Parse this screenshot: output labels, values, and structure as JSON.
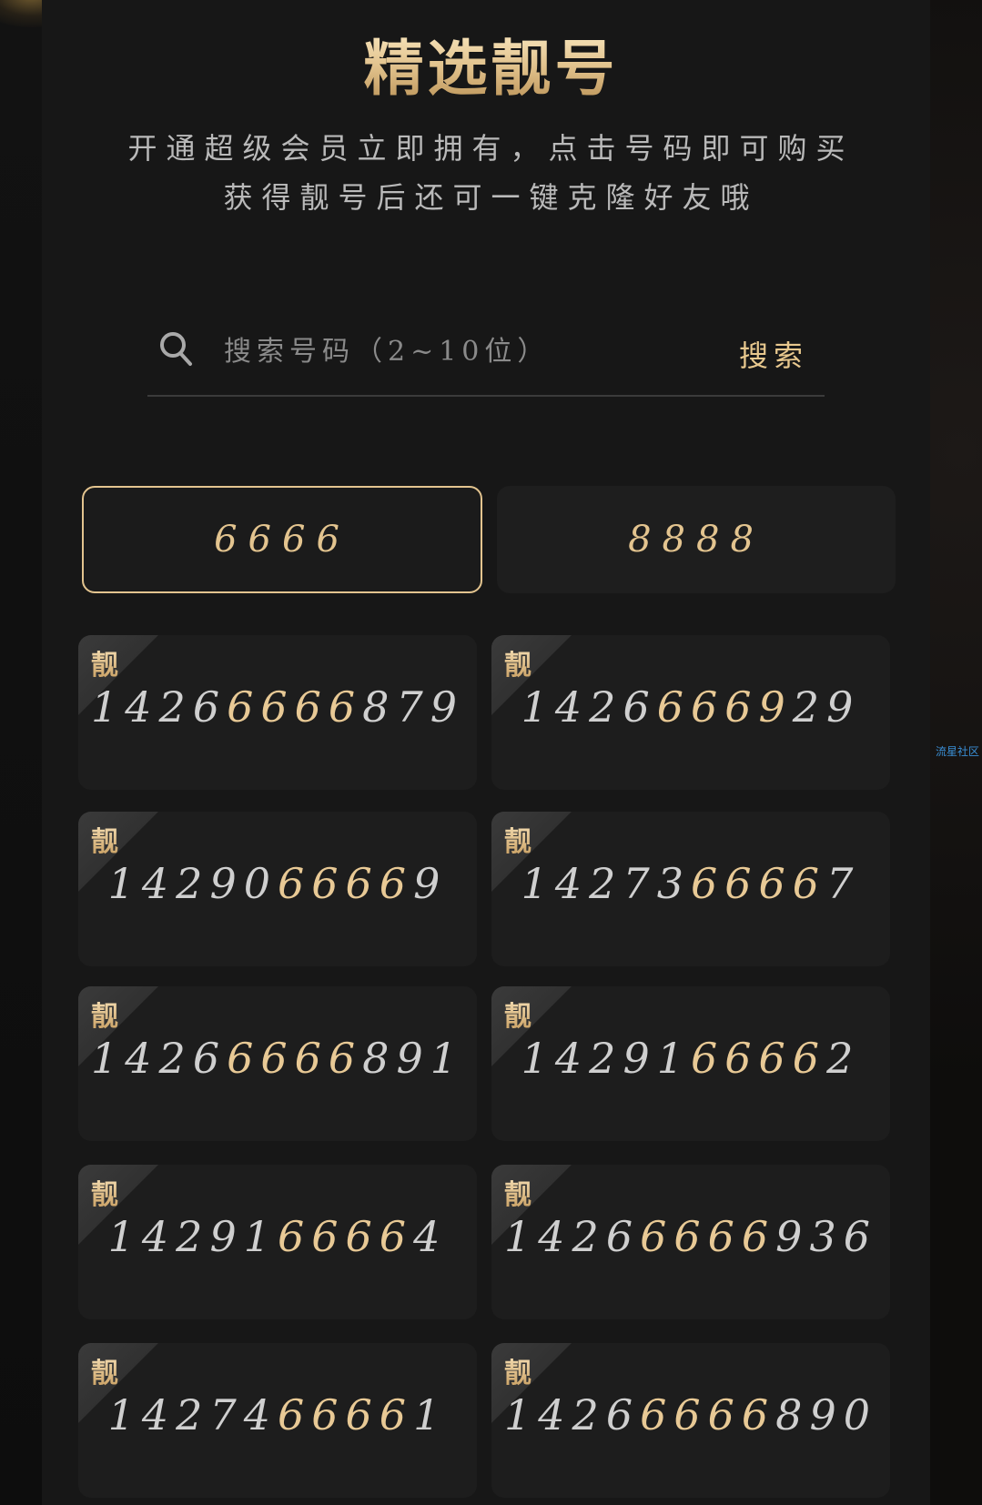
{
  "header": {
    "title": "精选靓号",
    "subtitle_line1": "开通超级会员立即拥有，点击号码即可购买",
    "subtitle_line2": "获得靓号后还可一键克隆好友哦"
  },
  "search": {
    "icon": "search-icon",
    "placeholder": "搜索号码（2~10位）",
    "value": "",
    "button_label": "搜索"
  },
  "tabs": [
    {
      "label": "6666",
      "active": true
    },
    {
      "label": "8888",
      "active": false
    }
  ],
  "badge_label": "靓",
  "numbers": [
    {
      "prefix": "1426",
      "highlight": "6666",
      "suffix": "879"
    },
    {
      "prefix": "1426",
      "highlight": "6669",
      "suffix": "29"
    },
    {
      "prefix": "14290",
      "highlight": "6666",
      "suffix": "9"
    },
    {
      "prefix": "14273",
      "highlight": "6666",
      "suffix": "7"
    },
    {
      "prefix": "1426",
      "highlight": "6666",
      "suffix": "891"
    },
    {
      "prefix": "14291",
      "highlight": "6666",
      "suffix": "2"
    },
    {
      "prefix": "14291",
      "highlight": "6666",
      "suffix": "4"
    },
    {
      "prefix": "1426",
      "highlight": "6666",
      "suffix": "936"
    },
    {
      "prefix": "14274",
      "highlight": "6666",
      "suffix": "1"
    },
    {
      "prefix": "1426",
      "highlight": "6666",
      "suffix": "890"
    }
  ],
  "watermark": "流星社区",
  "colors": {
    "gold": "#e3c48f",
    "panel": "#171717",
    "card": "#1d1d1d",
    "text_dim": "#b9b9b9"
  }
}
